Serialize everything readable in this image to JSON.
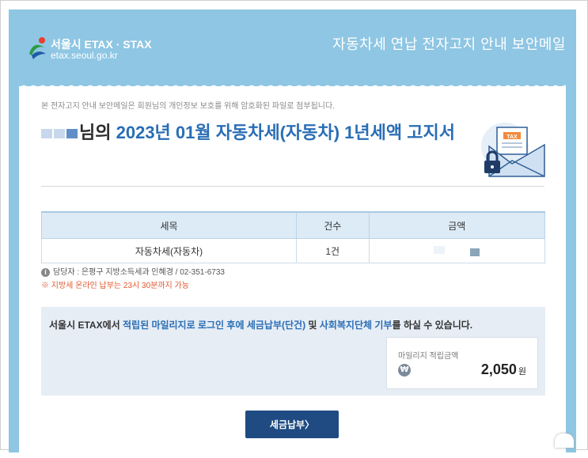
{
  "header": {
    "logo_top": "서울시 ETAX · STAX",
    "logo_bottom": "etax.seoul.go.kr",
    "title": "자동차세 연납 전자고지 안내 보안메일"
  },
  "notice": "본 전자고지 안내 보안메일은 회원님의 개인정보 보호를 위해 암호화된 파일로 첨부됩니다.",
  "title": {
    "suffix_dark": "님의",
    "highlight": "2023년 01월 자동차세(자동차) 1년세액 고지서"
  },
  "mail_icon": {
    "label": "TAX",
    "icon": "tax-envelope-icon"
  },
  "table": {
    "headers": [
      "세목",
      "건수",
      "금액"
    ],
    "rows": [
      [
        "자동차세(자동차)",
        "1건",
        ""
      ]
    ]
  },
  "contact": "담당자 : 은평구 지방소득세과 인혜경 / 02-351-6733",
  "warning": "※ 지방세 온라인 납부는 23시 30분까지 가능",
  "promo": {
    "text_prefix": "서울시 ETAX에서 ",
    "hl1": "적립된 마일리지로 로그인 후에 세금납부(단건)",
    "text_mid": " 및 ",
    "hl2": "사회복지단체 기부",
    "text_suffix": "를 하실 수 있습니다.",
    "mileage_label": "마일리지 적립금액",
    "mileage_value": "2,050",
    "mileage_unit": "원"
  },
  "pay_button": "세금납부〉",
  "colors": {
    "banner": "#8ec6e3",
    "accent": "#2a6db5",
    "button": "#1f4b82"
  }
}
